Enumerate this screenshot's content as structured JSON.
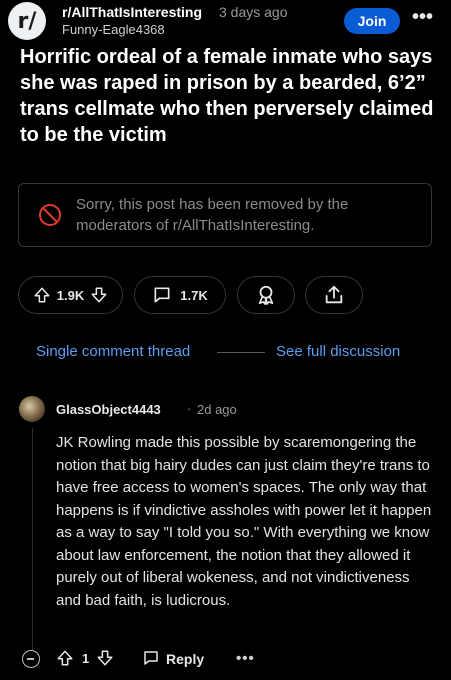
{
  "post": {
    "subreddit": "r/AllThatIsInteresting",
    "age": "3 days ago",
    "author": "Funny-Eagle4368",
    "join_label": "Join",
    "more_label": "•••",
    "icon_glyph": "r/",
    "title": "Horrific ordeal of a female inmate who says she was raped in prison by a bearded, 6’2” trans cellmate who then perversely claimed to be the victim",
    "removed_notice": "Sorry, this post has been removed by the moderators of r/AllThatIsInteresting.",
    "upvotes": "1.9K",
    "comments": "1.7K"
  },
  "thread_nav": {
    "single_label": "Single comment thread",
    "full_label": "See full discussion"
  },
  "comment": {
    "author": "GlassObject4443",
    "separator": "·",
    "age": "2d ago",
    "body": "JK Rowling made this possible by scaremongering the notion that big hairy dudes can just claim they're trans to have free access to women's spaces. The only way that happens is if vindictive assholes with power let it happen as a way to say \"I told you so.\" With everything we know about law enforcement, the notion that they allowed it purely out of liberal wokeness, and not vindictiveness and bad faith, is ludicrous.",
    "score": "1",
    "reply_label": "Reply",
    "more_label": "•••"
  },
  "colors": {
    "background": "#000000",
    "join_button": "#0a5cd6",
    "link": "#5b9cf0",
    "removed_text": "#8a8b8d",
    "removed_icon": "#e03a2f"
  },
  "icons": [
    "upvote-icon",
    "downvote-icon",
    "comment-icon",
    "award-icon",
    "share-icon",
    "removed-icon",
    "collapse-icon",
    "reply-icon"
  ]
}
